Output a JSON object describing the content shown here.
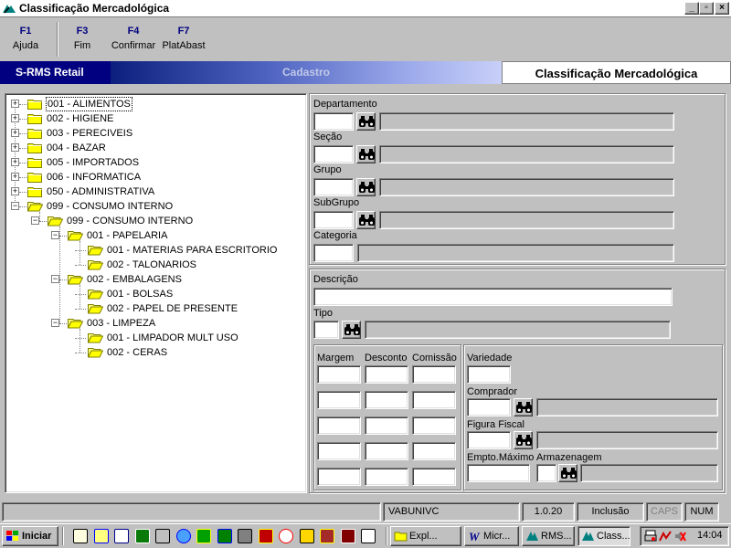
{
  "window": {
    "title": "Classificação Mercadológica",
    "controls": [
      "_",
      "▫",
      "×"
    ]
  },
  "toolbar": {
    "keys": [
      {
        "key": "F1",
        "label": "Ajuda"
      },
      {
        "key": "F3",
        "label": "Fim"
      },
      {
        "key": "F4",
        "label": "Confirmar"
      },
      {
        "key": "F7",
        "label": "PlatAbast"
      }
    ]
  },
  "header": {
    "brand": "S-RMS Retail",
    "section": "Cadastro",
    "screen": "Classificação Mercadológica"
  },
  "tree": {
    "nodes": [
      {
        "label": "001 - ALIMENTOS",
        "selected": true,
        "expanded": false
      },
      {
        "label": "002 - HIGIENE",
        "expanded": false
      },
      {
        "label": "003 - PERECIVEIS",
        "expanded": false
      },
      {
        "label": "004 - BAZAR",
        "expanded": false
      },
      {
        "label": "005 - IMPORTADOS",
        "expanded": false
      },
      {
        "label": "006 - INFORMATICA",
        "expanded": false
      },
      {
        "label": "050 - ADMINISTRATIVA",
        "expanded": false
      },
      {
        "label": "099 - CONSUMO INTERNO",
        "expanded": true
      },
      {
        "label": "099 - CONSUMO INTERNO",
        "expanded": true
      },
      {
        "label": "001 - PAPELARIA",
        "expanded": true
      },
      {
        "label": "001 - MATERIAS PARA ESCRITORIO"
      },
      {
        "label": "002 - TALONARIOS"
      },
      {
        "label": "002 - EMBALAGENS",
        "expanded": true
      },
      {
        "label": "001 - BOLSAS"
      },
      {
        "label": "002 - PAPEL DE PRESENTE"
      },
      {
        "label": "003 - LIMPEZA",
        "expanded": true
      },
      {
        "label": "001 - LIMPADOR MULT USO"
      },
      {
        "label": "002 - CERAS"
      }
    ]
  },
  "form": {
    "departamento": {
      "label": "Departamento",
      "code": "",
      "name": ""
    },
    "secao": {
      "label": "Seção",
      "code": "",
      "name": ""
    },
    "grupo": {
      "label": "Grupo",
      "code": "",
      "name": ""
    },
    "subgrupo": {
      "label": "SubGrupo",
      "code": "",
      "name": ""
    },
    "categoria": {
      "label": "Categoria",
      "code": "",
      "name": ""
    },
    "descricao": {
      "label": "Descrição",
      "value": ""
    },
    "tipo": {
      "label": "Tipo",
      "code": "",
      "name": ""
    },
    "grid_headers": {
      "margem": "Margem",
      "desconto": "Desconto",
      "comissao": "Comissão"
    },
    "variedade": {
      "label": "Variedade",
      "value": ""
    },
    "comprador": {
      "label": "Comprador",
      "code": "",
      "name": ""
    },
    "figura_fiscal": {
      "label": "Figura Fiscal",
      "code": "",
      "name": ""
    },
    "empto_maximo": {
      "label": "Empto.Máximo",
      "value": ""
    },
    "armazenagem": {
      "label": "Armazenagem",
      "code": "",
      "name": ""
    }
  },
  "status": {
    "user": "VABUNIVC",
    "version": "1.0.20",
    "mode": "Inclusão",
    "caps": "CAPS",
    "num": "NUM"
  },
  "taskbar": {
    "start": "Iniciar",
    "tasks": [
      "Expl...",
      "Micr...",
      "RMS...",
      "Class..."
    ],
    "clock": "14:04"
  },
  "colors": {
    "window_bg": "#c0c0c0",
    "brand_blue": "#000080",
    "function_key": "#000080"
  }
}
